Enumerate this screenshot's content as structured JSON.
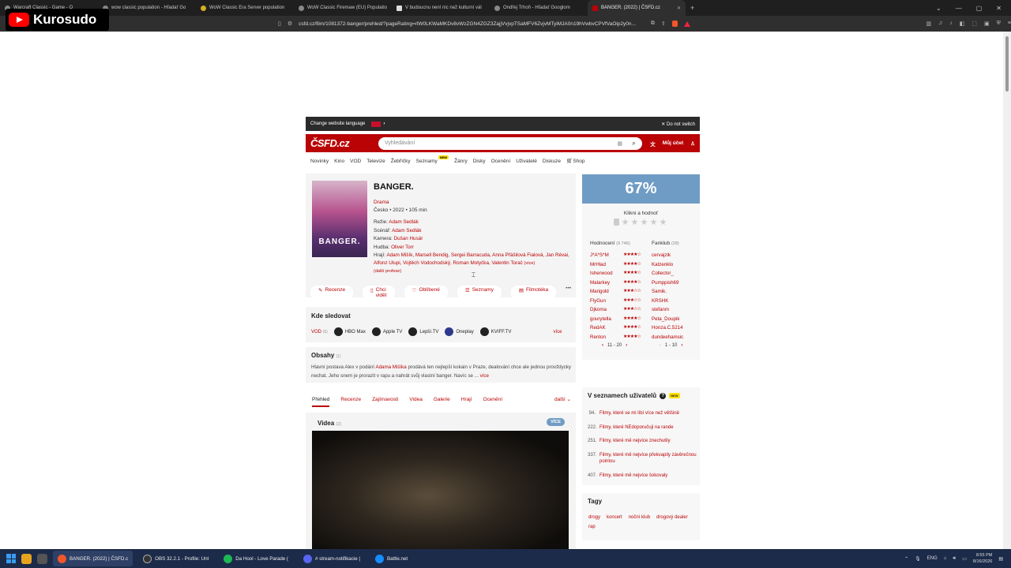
{
  "browser": {
    "tabs": [
      {
        "title": "Warcraft Classic - Game - O"
      },
      {
        "title": "wow classic population - Hľadať Go"
      },
      {
        "title": "WoW Classic Era Server population"
      },
      {
        "title": "WoW Classic Firemaw (EU) Populatio"
      },
      {
        "title": "V budoucnu není nic než kulturní vál"
      },
      {
        "title": "Ondřej Trhoň - Hľadať Googlom"
      },
      {
        "title": "BANGER. (2022) | ČSFD.cz",
        "active": true
      }
    ],
    "url": "csfd.cz/film/1081372-banger/prehled/?pageRating=rlW0LKWaMKDv8vWzZGN4ZGZ3ZajjVvjvpTSaMFV6ZvjvMTyiMJA0n19hVwbvCPVfVaOip2y0n..."
  },
  "overlay": {
    "channel_name": "Kurosudo"
  },
  "lang_bar": {
    "text": "Change website language",
    "dont_switch": "Do not switch"
  },
  "header": {
    "search_placeholder": "Vyhledávání",
    "account": "Můj účet"
  },
  "nav": [
    "Novinky",
    "Kino",
    "VOD",
    "Televize",
    "Žebříčky",
    "Seznamy",
    "Žánry",
    "Disky",
    "Ocenění",
    "Uživatelé",
    "Diskuze",
    "Shop"
  ],
  "nav_new_badge": "NEW",
  "film": {
    "poster_text": "BANGER.",
    "title": "BANGER.",
    "genre": "Drama",
    "origin": "Česko • 2022 • 105 min",
    "credits": [
      {
        "label": "Režie:",
        "value": "Adam Sedlák"
      },
      {
        "label": "Scénář:",
        "value": "Adam Sedlák"
      },
      {
        "label": "Kamera:",
        "value": "Dušan Husár"
      },
      {
        "label": "Hudba:",
        "value": "Oliver Torr"
      },
      {
        "label": "Hrají:",
        "value": "Adam Mišík, Marsell Bendig, Sergei Barracuda, Anna Přášilová Fialová, Jan Révai, Alfonz Ulupi, Vojtěch Vodochodský, Roman Motyčka, Valentin Torač"
      }
    ],
    "credits_vice": "více",
    "credits_more": "(další profese)",
    "actions": [
      "Recenze",
      "Chci vidět",
      "Oblíbené",
      "Seznamy",
      "Filmotéka"
    ],
    "actions_more": "•••"
  },
  "rating": {
    "percent": "67%",
    "click_rate": "Klikni a hodnoť",
    "ratings_label": "Hodnocení",
    "ratings_count": "(9 746)",
    "fanclub_label": "Fanklub",
    "fanclub_count": "(28)",
    "users": [
      {
        "name": "J*A*S*M",
        "stars": "★★★★☆"
      },
      {
        "name": "MrHlad",
        "stars": "★★★★☆"
      },
      {
        "name": "Isherwood",
        "stars": "★★★★☆"
      },
      {
        "name": "Malarkey",
        "stars": "★★★★☆"
      },
      {
        "name": "Marigold",
        "stars": "★★★☆☆"
      },
      {
        "name": "FlyGun",
        "stars": "★★★☆☆"
      },
      {
        "name": "Djkoma",
        "stars": "★★★☆☆"
      },
      {
        "name": "gourytella",
        "stars": "★★★★☆"
      },
      {
        "name": "RedAK",
        "stars": "★★★★☆"
      },
      {
        "name": "Renton",
        "stars": "★★★★☆"
      }
    ],
    "fans": [
      "cervajzik",
      "Katzenklo",
      "Collector_",
      "Pumppish69",
      "Samik.",
      "KRSHK",
      "stefanm",
      "Peta_Doupik",
      "Honza.C.5214",
      "dundeehamsic"
    ],
    "pager_left": "11 - 20",
    "pager_right": "1 - 10"
  },
  "where": {
    "title": "Kde sledovat",
    "vod_label": "VOD",
    "vod_count": "(6)",
    "services": [
      "HBO Max",
      "Apple TV",
      "Lepší.TV",
      "Oneplay",
      "KVIFF.TV"
    ],
    "vice": "více"
  },
  "content": {
    "title": "Obsahy",
    "count": "(1)",
    "text_before": "Hlavní postava Alex v podání",
    "actor": "Adama Mišíka",
    "text_after": "prodává ten nejlepší kokain v Praze, dealování chce ale jednou provždycky nechat. Jeho snem je prorazit v rapu a nahrát svůj vlastní banger. Navíc se ...",
    "vice": "více"
  },
  "tabs": [
    "Přehled",
    "Recenze",
    "Zajímavosti",
    "Videa",
    "Galerie",
    "Hrají",
    "Ocenění"
  ],
  "tabs_more": "další",
  "videos": {
    "title": "Videa",
    "count": "(2)",
    "badge": "VÍCE"
  },
  "user_lists": {
    "title": "V seznamech uživatelů",
    "badge": "NEW",
    "items": [
      {
        "num": "94.",
        "text": "Filmy, které se mi líbí více než většině"
      },
      {
        "num": "222.",
        "text": "Filmy, které NEdoporučuji na rande"
      },
      {
        "num": "251.",
        "text": "Filmy, které mě nejvíce znechutily"
      },
      {
        "num": "337.",
        "text": "Filmy, které mě nejvíce překvapily závěrečnou pointou"
      },
      {
        "num": "407.",
        "text": "Filmy, které mě nejvíce šokovaly"
      }
    ]
  },
  "tags": {
    "title": "Tagy",
    "items": [
      "drogy",
      "koncert",
      "noční klub",
      "drogový dealer",
      "rap"
    ]
  },
  "taskbar": {
    "items": [
      "BANGER. (2022) | ČSFD.c",
      "OBS 32.2.1 - Profile: Unt",
      "Da Hool - Love Parade (",
      "# stream-notifikacie |",
      "Battle.net"
    ],
    "lang": "ENG",
    "time": "8:55 PM",
    "date": "8/16/2026"
  }
}
